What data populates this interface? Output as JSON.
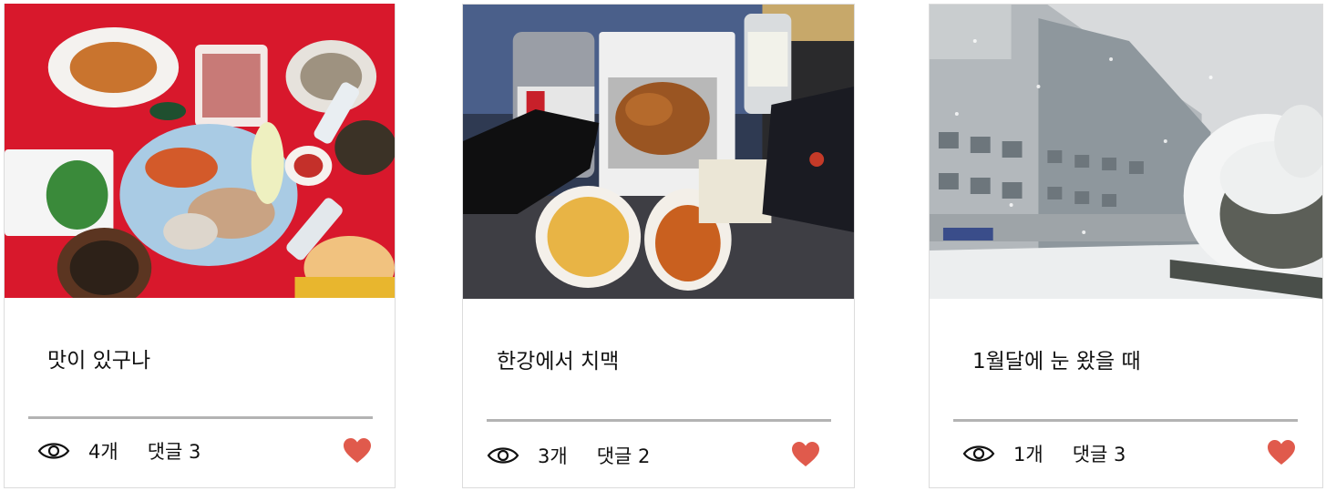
{
  "colors": {
    "heart": "#e05a4c",
    "divider": "#b3b3b3"
  },
  "cards": [
    {
      "title": "맛이 있구나",
      "views": "4개",
      "comments": "댓글 3",
      "photo": "food-table-photo"
    },
    {
      "title": "한강에서 치맥",
      "views": "3개",
      "comments": "댓글 2",
      "photo": "chicken-beer-photo"
    },
    {
      "title": "1월달에 눈 왔을 때",
      "views": "1개",
      "comments": "댓글 3",
      "photo": "snow-building-photo"
    }
  ],
  "icons": {
    "views": "eye-icon",
    "like": "heart-icon"
  }
}
